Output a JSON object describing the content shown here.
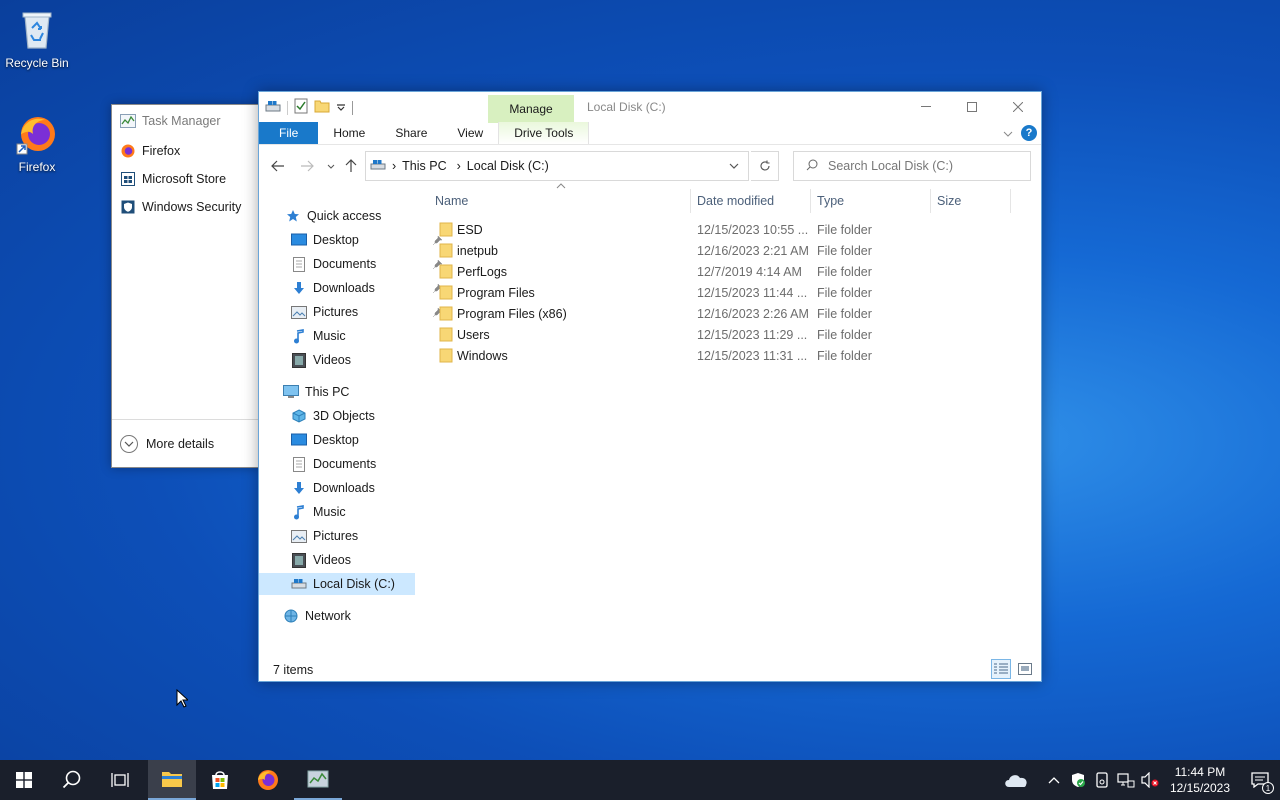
{
  "desktop": {
    "icons": [
      {
        "label": "Recycle Bin"
      },
      {
        "label": "Firefox"
      }
    ]
  },
  "task_manager": {
    "title": "Task Manager",
    "apps": [
      {
        "label": "Firefox"
      },
      {
        "label": "Microsoft Store"
      },
      {
        "label": "Windows Security"
      }
    ],
    "more_details": "More details"
  },
  "explorer": {
    "window_title": "Local Disk (C:)",
    "contextual_tab": "Manage",
    "ribbon_tabs": [
      "File",
      "Home",
      "Share",
      "View",
      "Drive Tools"
    ],
    "breadcrumb": [
      "This PC",
      "Local Disk (C:)"
    ],
    "search_placeholder": "Search Local Disk (C:)",
    "nav": {
      "quick_access": "Quick access",
      "quick_items": [
        "Desktop",
        "Documents",
        "Downloads",
        "Pictures",
        "Music",
        "Videos"
      ],
      "this_pc": "This PC",
      "pc_items": [
        "3D Objects",
        "Desktop",
        "Documents",
        "Downloads",
        "Music",
        "Pictures",
        "Videos",
        "Local Disk (C:)"
      ],
      "network": "Network"
    },
    "columns": [
      "Name",
      "Date modified",
      "Type",
      "Size"
    ],
    "files": [
      {
        "name": "ESD",
        "date": "12/15/2023 10:55 ...",
        "type": "File folder"
      },
      {
        "name": "inetpub",
        "date": "12/16/2023 2:21 AM",
        "type": "File folder"
      },
      {
        "name": "PerfLogs",
        "date": "12/7/2019 4:14 AM",
        "type": "File folder"
      },
      {
        "name": "Program Files",
        "date": "12/15/2023 11:44 ...",
        "type": "File folder"
      },
      {
        "name": "Program Files (x86)",
        "date": "12/16/2023 2:26 AM",
        "type": "File folder"
      },
      {
        "name": "Users",
        "date": "12/15/2023 11:29 ...",
        "type": "File folder"
      },
      {
        "name": "Windows",
        "date": "12/15/2023 11:31 ...",
        "type": "File folder"
      }
    ],
    "status": "7 items"
  },
  "taskbar": {
    "time": "11:44 PM",
    "date": "12/15/2023",
    "notification_count": "1"
  }
}
